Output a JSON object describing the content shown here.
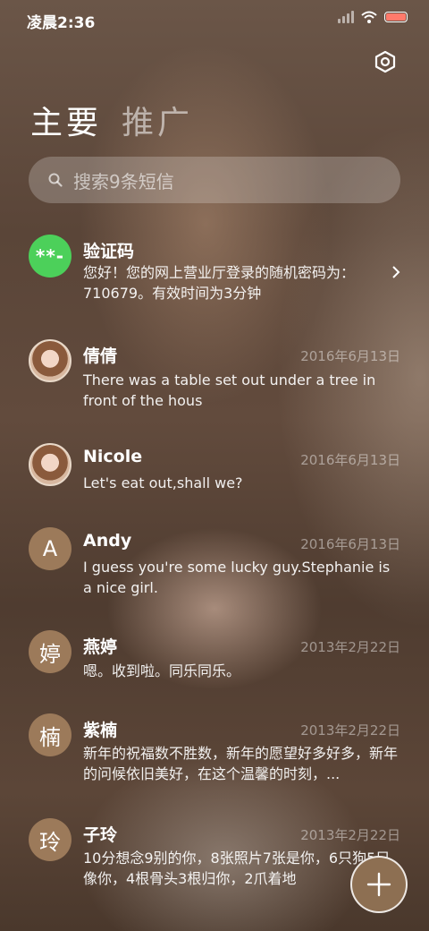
{
  "status_bar": {
    "time": "凌晨2:36"
  },
  "tabs": {
    "main": "主要",
    "promo": "推广"
  },
  "search": {
    "placeholder": "搜索9条短信"
  },
  "conversations": [
    {
      "avatar_text": "**-",
      "avatar_type": "green",
      "name": "验证码",
      "date": "",
      "preview": "您好！您的网上营业厅登录的随机密码为：710679。有效时间为3分钟"
    },
    {
      "avatar_text": "",
      "avatar_type": "photo",
      "name": "倩倩",
      "date": "2016年6月13日",
      "preview": "There was a table set out under a tree in front of the hous"
    },
    {
      "avatar_text": "",
      "avatar_type": "photo",
      "name": "Nicole",
      "date": "2016年6月13日",
      "preview": "Let's eat out,shall we?"
    },
    {
      "avatar_text": "A",
      "avatar_type": "letter",
      "name": "Andy",
      "date": "2016年6月13日",
      "preview": "I guess you're some lucky guy.Stephanie is a nice girl."
    },
    {
      "avatar_text": "婷",
      "avatar_type": "letter",
      "name": "燕婷",
      "date": "2013年2月22日",
      "preview": "嗯。收到啦。同乐同乐。"
    },
    {
      "avatar_text": "楠",
      "avatar_type": "letter",
      "name": "紫楠",
      "date": "2013年2月22日",
      "preview": "新年的祝福数不胜数，新年的愿望好多好多，新年的问候依旧美好，在这个温馨的时刻，..."
    },
    {
      "avatar_text": "玲",
      "avatar_type": "letter",
      "name": "子玲",
      "date": "2013年2月22日",
      "preview": "10分想念9别的你，8张照片7张是你，6只狗5只像你，4根骨头3根归你，2爪着地"
    }
  ],
  "icons": {
    "settings": "gear-icon",
    "search": "search-icon",
    "compose": "plus-icon",
    "chevron": "chevron-right-icon"
  },
  "colors": {
    "avatar_letter_bg": "#9c7a5a",
    "avatar_green_bg": "#4cd05a",
    "fab_bg": "#8d6f52"
  }
}
